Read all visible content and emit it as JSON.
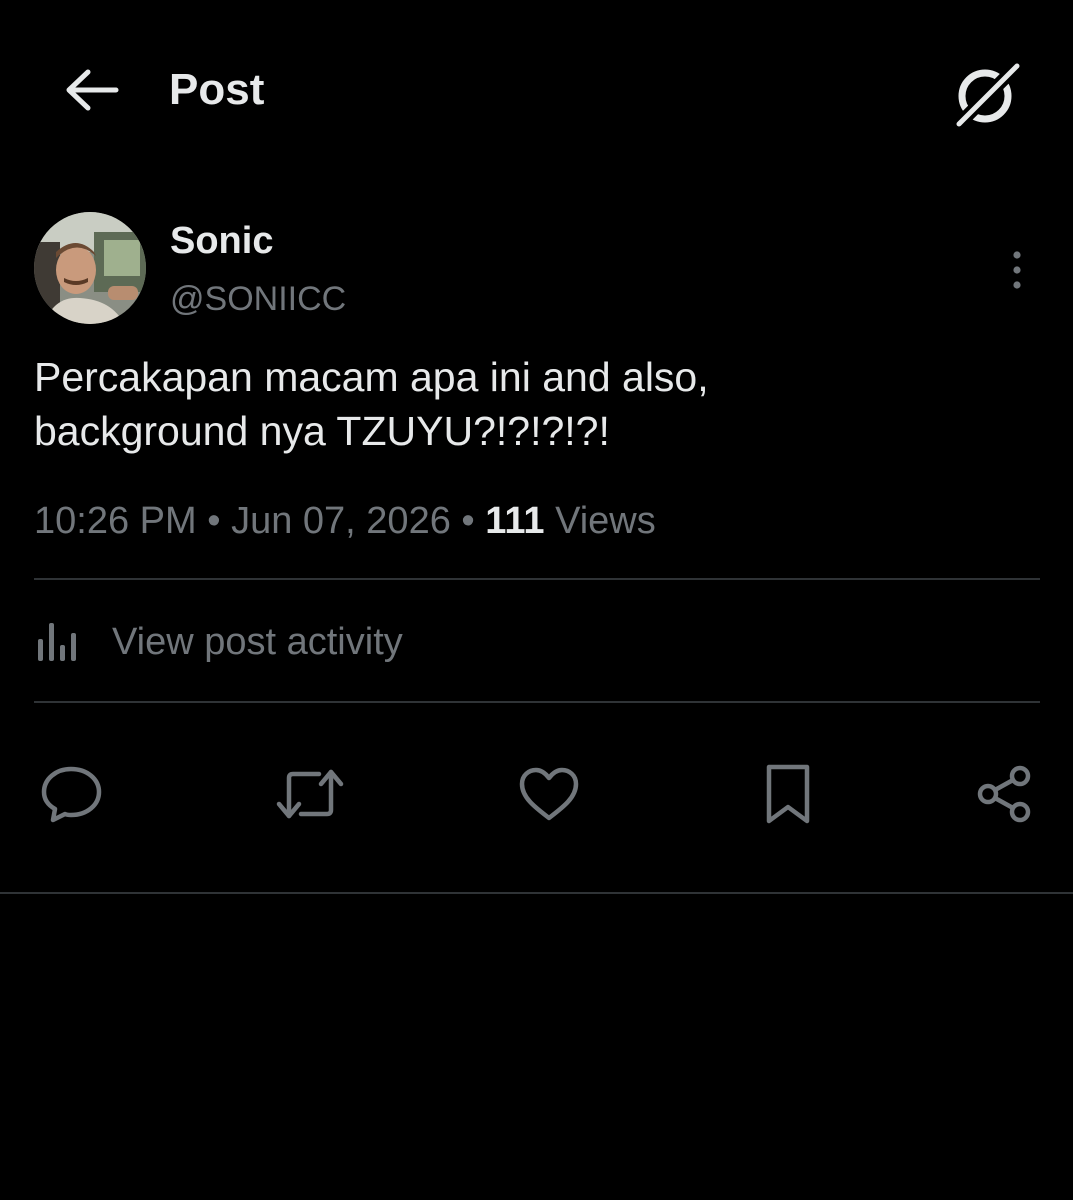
{
  "header": {
    "title": "Post",
    "back_icon": "arrow-left-icon",
    "grok_icon": "grok-icon"
  },
  "author": {
    "name": "Sonic",
    "handle": "@SONIICC",
    "avatar": "avatar-photo"
  },
  "post": {
    "text_lines": [
      "Percakapan macam apa ini and also,",
      "background nya TZUYU?!?!?!?!"
    ],
    "time": "10:26 PM",
    "date": "Jun 07, 2026",
    "separator": "•",
    "views_count": "111",
    "views_label": "Views"
  },
  "activity": {
    "label": "View post activity",
    "icon": "analytics-bars-icon"
  },
  "actions": [
    {
      "name": "reply",
      "icon": "reply-icon"
    },
    {
      "name": "repost",
      "icon": "repost-icon"
    },
    {
      "name": "like",
      "icon": "heart-icon"
    },
    {
      "name": "bookmark",
      "icon": "bookmark-icon"
    },
    {
      "name": "share",
      "icon": "share-icon"
    }
  ],
  "colors": {
    "background": "#000000",
    "primary_text": "#e7e9ea",
    "secondary_text": "#71767b",
    "divider": "#2f3336"
  }
}
